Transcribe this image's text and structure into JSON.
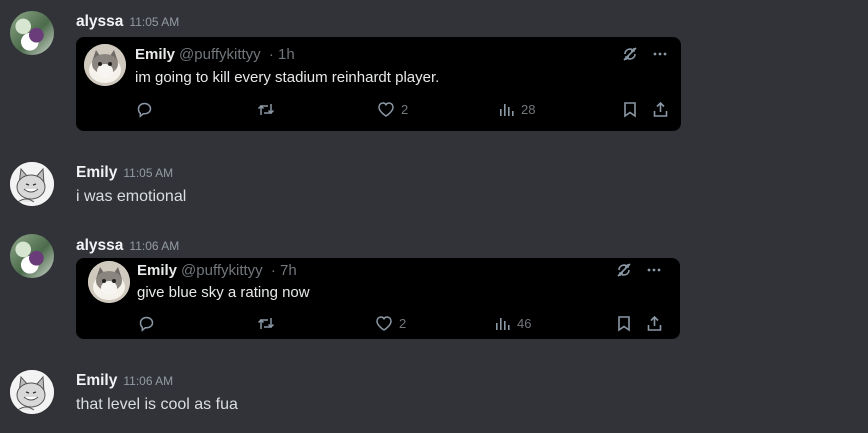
{
  "messages": [
    {
      "author": "alyssa",
      "time": "11:05 AM",
      "embed": {
        "author": "Emily",
        "handle": "@puffykittyy",
        "age": "· 1h",
        "text": "im going to kill every stadium reinhardt player.",
        "likes": "2",
        "views": "28"
      }
    },
    {
      "author": "Emily",
      "time": "11:05 AM",
      "text": "i was emotional"
    },
    {
      "author": "alyssa",
      "time": "11:06 AM",
      "embed": {
        "author": "Emily",
        "handle": "@puffykittyy",
        "age": "· 7h",
        "text": "give blue sky a rating now",
        "likes": "2",
        "views": "46"
      }
    },
    {
      "author": "Emily",
      "time": "11:06 AM",
      "text": "that level is cool as fua"
    }
  ],
  "icons": {
    "reply": "reply-icon",
    "repost": "repost-icon",
    "like": "heart-icon",
    "views": "views-icon",
    "bookmark": "bookmark-icon",
    "share": "share-icon",
    "refresh": "refresh-icon",
    "more": "more-icon"
  },
  "colors": {
    "background": "#313338",
    "embed_background": "#000000",
    "timestamp": "#949ba4"
  }
}
